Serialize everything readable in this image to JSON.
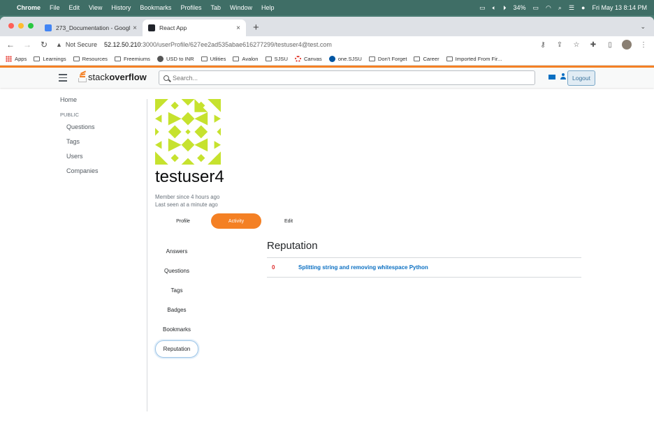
{
  "menubar": {
    "app": "Chrome",
    "items": [
      "File",
      "Edit",
      "View",
      "History",
      "Bookmarks",
      "Profiles",
      "Tab",
      "Window",
      "Help"
    ],
    "battery": "34%",
    "datetime": "Fri May 13  8:14 PM"
  },
  "browser": {
    "tabs": [
      {
        "title": "273_Documentation - Google",
        "close": "×"
      },
      {
        "title": "React App",
        "close": "×"
      }
    ],
    "new_tab": "+",
    "security_label": "Not Secure",
    "url_host": "52.12.50.210",
    "url_path": ":3000/userProfile/627ee2ad535abae616277299/testuser4@test.com",
    "bookmarks": [
      "Apps",
      "Learnings",
      "Resources",
      "Freemiums",
      "USD to INR",
      "Utlities",
      "Avalon",
      "SJSU",
      "Canvas",
      "one.SJSU",
      "Don't Forget",
      "Career",
      "Imported From Fir..."
    ]
  },
  "header": {
    "logo_plain": "stack",
    "logo_bold": "overflow",
    "search_placeholder": "Search...",
    "logout": "Logout",
    "accent": "#f48024"
  },
  "leftnav": {
    "home": "Home",
    "public": "PUBLIC",
    "items": [
      "Questions",
      "Tags",
      "Users",
      "Companies"
    ]
  },
  "profile": {
    "username": "testuser4",
    "member_since": "Member since 4 hours ago",
    "last_seen": "Last seen at a minute ago",
    "tabs": [
      "Profile",
      "Activity",
      "Edit"
    ],
    "active_tab": "Activity"
  },
  "activity": {
    "nav": [
      "Answers",
      "Questions",
      "Tags",
      "Badges",
      "Bookmarks",
      "Reputation"
    ],
    "selected": "Reputation",
    "section_title": "Reputation",
    "rows": [
      {
        "value": "0",
        "title": "Splitting string and removing whitespace Python"
      }
    ]
  }
}
